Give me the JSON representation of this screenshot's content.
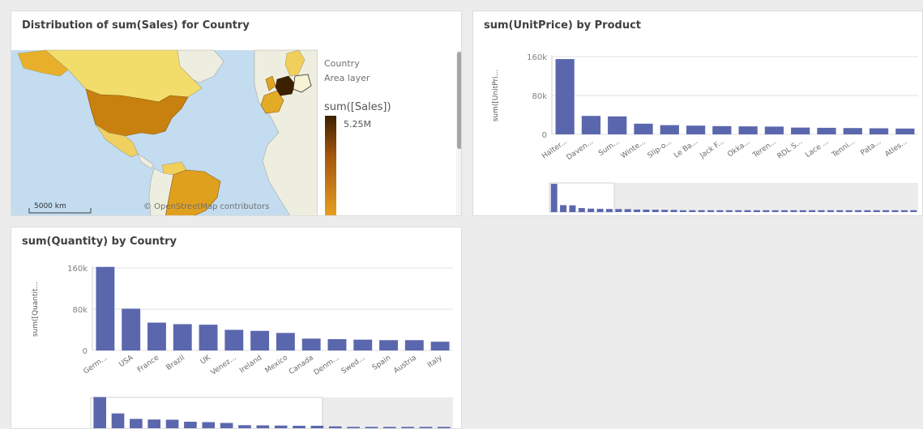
{
  "colors": {
    "bar": "#5b67ad",
    "ocean": "#c3dcef",
    "land": "#eeeee0",
    "country_low": "#f3dd6a",
    "country_mid": "#dfa01e",
    "country_high": "#cb7f0e",
    "country_max": "#4a2600"
  },
  "map_panel": {
    "title": "Distribution of sum(Sales) for Country",
    "legend": {
      "dimension": "Country",
      "layer": "Area layer",
      "measure": "sum([Sales])",
      "max_label": "5.25M"
    },
    "scale_label": "5000 km",
    "attribution": "© OpenStreetMap contributors"
  },
  "chart_data": [
    {
      "type": "bar",
      "title": "sum(UnitPrice) by Product",
      "ylabel": "sum([UnitPri...",
      "ylim": [
        0,
        160000
      ],
      "yticks": [
        "160k",
        "80k",
        "0"
      ],
      "categories": [
        "Halter...",
        "Daven...",
        "Sum...",
        "Winte...",
        "Slip-o...",
        "Le Ba...",
        "Jack F...",
        "Okka...",
        "Teren...",
        "RDL S...",
        "Lace ...",
        "Tenni...",
        "Pata...",
        "Atles..."
      ],
      "values": [
        155000,
        38000,
        37000,
        22000,
        19000,
        18000,
        17000,
        16500,
        16000,
        14000,
        13500,
        13000,
        12500,
        12000
      ],
      "scrollbar": true
    },
    {
      "type": "bar",
      "title": "sum(Quantity) by Country",
      "ylabel": "sum([Quantit...",
      "ylim": [
        0,
        160000
      ],
      "yticks": [
        "160k",
        "80k",
        "0"
      ],
      "categories": [
        "Germ...",
        "USA",
        "France",
        "Brazil",
        "UK",
        "Venez...",
        "Ireland",
        "Mexico",
        "Canada",
        "Denm...",
        "Swed...",
        "Spain",
        "Austria",
        "Italy"
      ],
      "values": [
        162000,
        81000,
        54000,
        51000,
        50000,
        40000,
        38000,
        34000,
        23000,
        22000,
        21000,
        20000,
        20000,
        17000
      ],
      "scrollbar": true
    }
  ]
}
